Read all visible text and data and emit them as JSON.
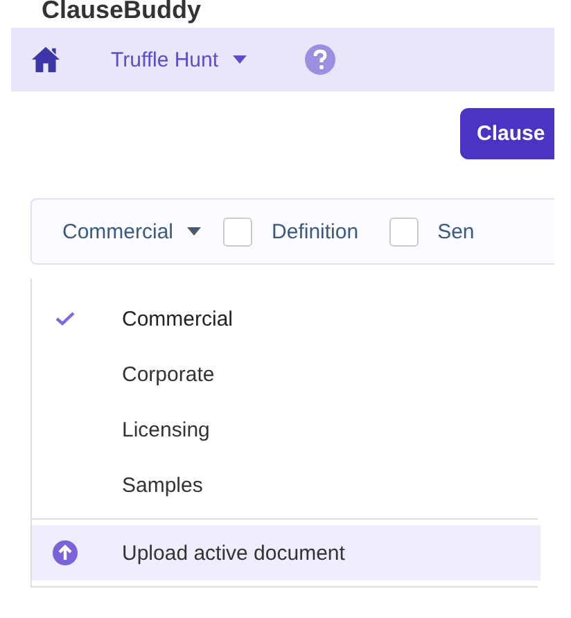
{
  "app_title": "ClauseBuddy",
  "nav": {
    "project": "Truffle Hunt"
  },
  "clauses_button": "Clause",
  "filter_bar": {
    "category": "Commercial",
    "checkboxes": [
      {
        "label": "Definition",
        "checked": false
      },
      {
        "label": "Sen",
        "checked": false
      }
    ]
  },
  "dropdown": {
    "items": [
      {
        "label": "Commercial",
        "selected": true
      },
      {
        "label": "Corporate",
        "selected": false
      },
      {
        "label": "Licensing",
        "selected": false
      },
      {
        "label": "Samples",
        "selected": false
      }
    ],
    "action": "Upload active document"
  }
}
